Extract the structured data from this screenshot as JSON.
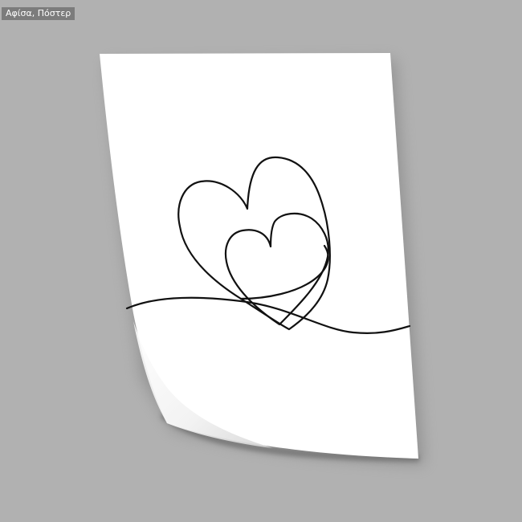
{
  "badge": {
    "text": "Αφίσα, Πόστερ"
  },
  "colors": {
    "background": "#b1b1b1",
    "badge_background": "#7c7c7c",
    "badge_text": "#ffffff",
    "paper": "#ffffff",
    "artwork_line": "#111111"
  },
  "artwork": {
    "subject": "line-art-two-hearts-icon"
  }
}
